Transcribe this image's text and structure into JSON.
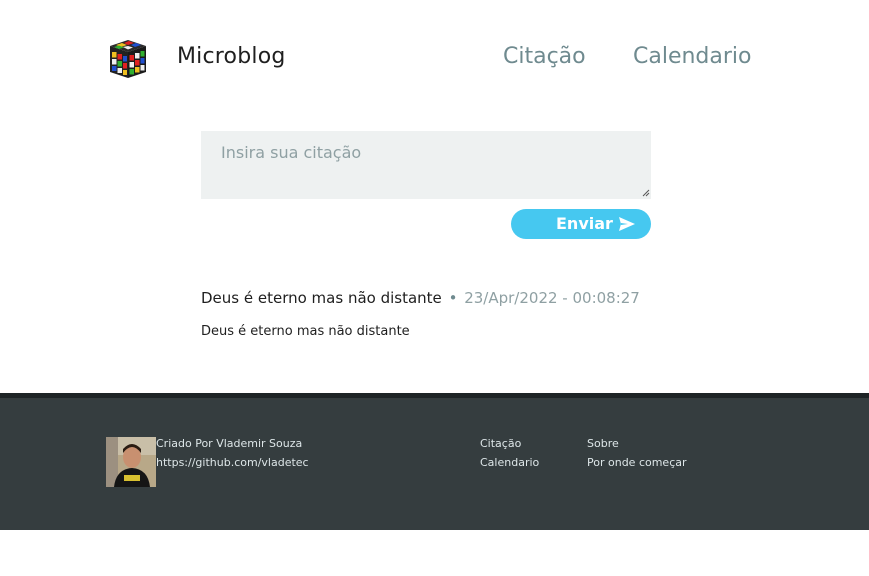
{
  "header": {
    "brand": "Microblog",
    "nav": [
      "Citação",
      "Calendario"
    ]
  },
  "form": {
    "placeholder": "Insira sua citação",
    "value": "",
    "submit_label": "Enviar"
  },
  "posts": [
    {
      "title": "Deus é eterno mas não distante",
      "separator": "•",
      "date": "23/Apr/2022 - 00:08:27",
      "body": "Deus é eterno mas não distante"
    }
  ],
  "footer": {
    "author": "Criado Por Vlademir Souza",
    "github": "https://github.com/vladetec",
    "col1": [
      "Citação",
      "Calendario"
    ],
    "col2": [
      "Sobre",
      "Por onde começar"
    ]
  },
  "colors": {
    "accent": "#46c8f0",
    "nav": "#6f8a8f",
    "footer_bg": "#353d3f"
  }
}
